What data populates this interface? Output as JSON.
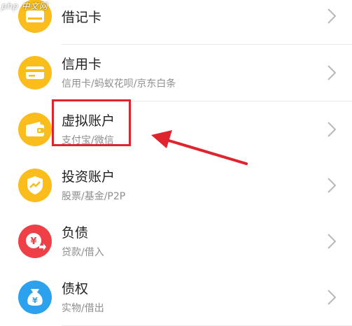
{
  "watermark": "php 中文网",
  "colors": {
    "yellow": "#fbbd1b",
    "red": "#ef4047",
    "blue": "#2ca2ee",
    "highlight": "#e0242e"
  },
  "items": [
    {
      "title": "借记卡",
      "subtitle": "",
      "icon": "debit-card-icon"
    },
    {
      "title": "信用卡",
      "subtitle": "信用卡/蚂蚁花呗/京东白条",
      "icon": "credit-card-icon"
    },
    {
      "title": "虚拟账户",
      "subtitle": "支付宝/微信",
      "icon": "wallet-icon"
    },
    {
      "title": "投资账户",
      "subtitle": "股票/基金/P2P",
      "icon": "investment-shield-icon"
    },
    {
      "title": "负债",
      "subtitle": "贷款/借入",
      "icon": "yuan-debt-icon"
    },
    {
      "title": "债权",
      "subtitle": "实物/借出",
      "icon": "money-bag-icon"
    }
  ]
}
